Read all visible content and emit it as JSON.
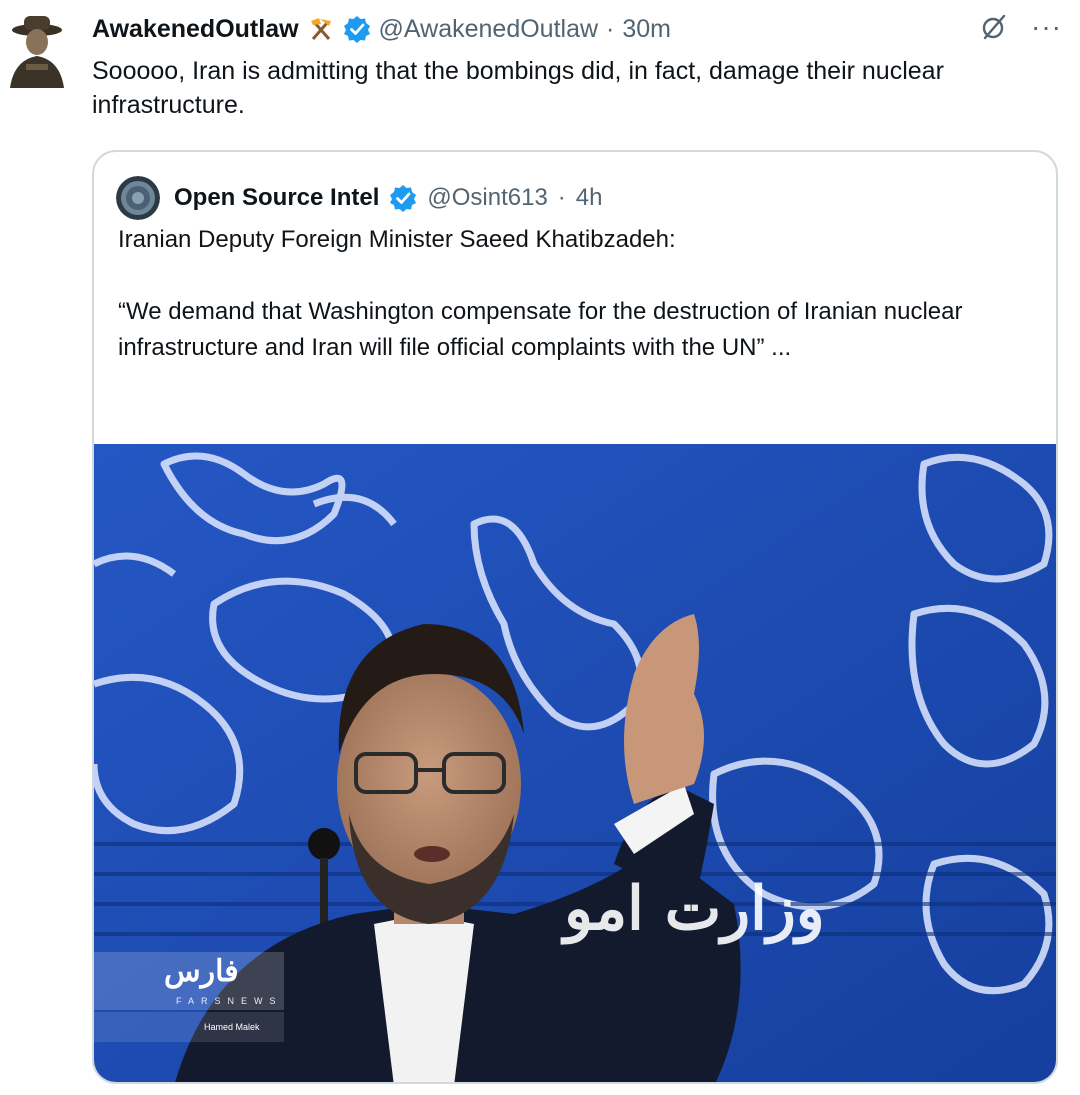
{
  "tweet": {
    "display_name": "AwakenedOutlaw",
    "handle": "@AwakenedOutlaw",
    "separator": "·",
    "time": "30m",
    "text": "Sooooo, Iran is admitting that the bombings did, in fact, damage their nuclear infrastructure.",
    "more_glyph": "···",
    "icons": [
      "avatar",
      "hammer-pick-icon",
      "verified-badge-icon",
      "grok-icon",
      "more-icon"
    ]
  },
  "quote": {
    "display_name": "Open Source Intel",
    "handle": "@Osint613",
    "separator": "·",
    "time": "4h",
    "text_line1": "Iranian Deputy Foreign Minister Saeed Khatibzadeh:",
    "text_line2": "“We demand that Washington compensate for the destruction of Iranian nuclear infrastructure and Iran will file official complaints with the UN” ...",
    "media": {
      "description_icon": "press-conference-photo",
      "watermark_logo": "فارس",
      "watermark_sub": "FARSNEWS",
      "watermark_credit": "Hamed Malek",
      "wall_text": "وزارت امو"
    }
  },
  "colors": {
    "text": "#0f1419",
    "secondary": "#536471",
    "verified": "#1d9bf0",
    "border": "#cfd9de",
    "backdrop_blue": "#1e4fb4"
  }
}
